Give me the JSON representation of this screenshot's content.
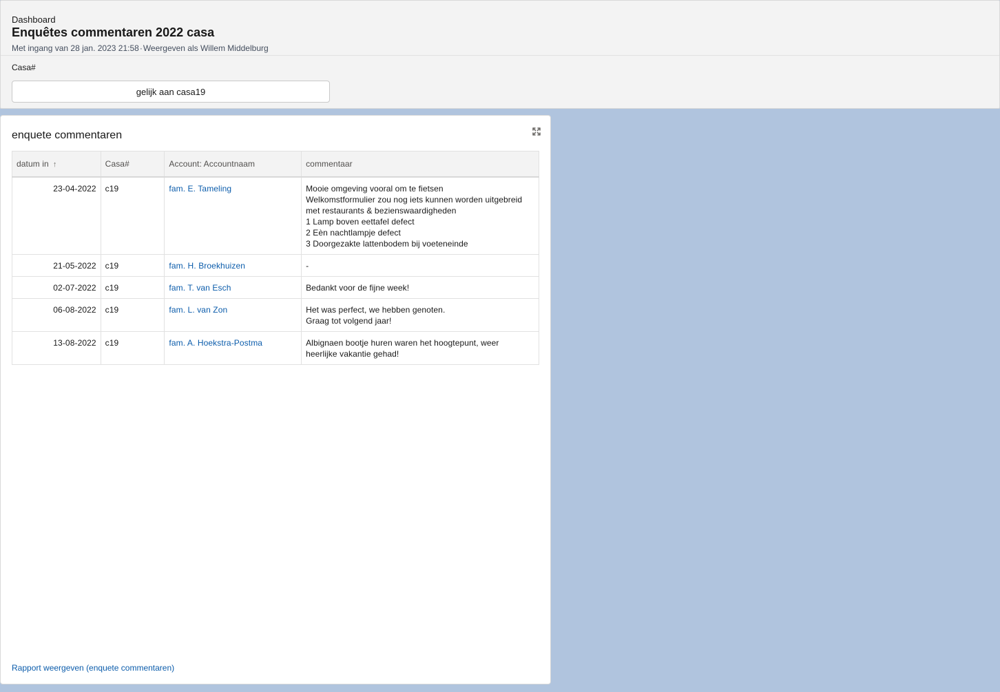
{
  "header": {
    "eyebrow": "Dashboard",
    "title": "Enquêtes commentaren 2022 casa",
    "as_of": "Met ingang van 28 jan. 2023 21:58",
    "separator": "·",
    "view_as": "Weergeven als Willem Middelburg"
  },
  "filter": {
    "label": "Casa#",
    "value": "gelijk aan casa19"
  },
  "widget": {
    "title": "enquete commentaren",
    "expand_icon": "expand-icon",
    "columns": [
      "datum in",
      "Casa#",
      "Account: Accountnaam",
      "commentaar"
    ],
    "sort_indicator": "↑",
    "rows": [
      {
        "date": "23-04-2022",
        "casa": "c19",
        "account": "fam. E. Tameling",
        "comment": [
          "Mooie omgeving vooral om te fietsen",
          "Welkomstformulier zou nog iets kunnen worden uitgebreid",
          "met restaurants & bezienswaardigheden",
          "1 Lamp boven eettafel defect",
          "2 Eèn nachtlampje defect",
          "3 Doorgezakte lattenbodem bij voeteneinde"
        ]
      },
      {
        "date": "21-05-2022",
        "casa": "c19",
        "account": "fam. H. Broekhuizen",
        "comment": [
          "-"
        ]
      },
      {
        "date": "02-07-2022",
        "casa": "c19",
        "account": "fam. T. van Esch",
        "comment": [
          "Bedankt voor de fijne week!"
        ]
      },
      {
        "date": "06-08-2022",
        "casa": "c19",
        "account": "fam. L. van Zon",
        "comment": [
          "Het was perfect, we hebben genoten.",
          "Graag tot volgend jaar!"
        ]
      },
      {
        "date": "13-08-2022",
        "casa": "c19",
        "account": "fam. A. Hoekstra-Postma",
        "comment": [
          "Albignaen bootje huren waren het hoogtepunt, weer",
          "heerlijke vakantie gehad!"
        ]
      }
    ],
    "footer_link": "Rapport weergeven (enquete commentaren)"
  }
}
